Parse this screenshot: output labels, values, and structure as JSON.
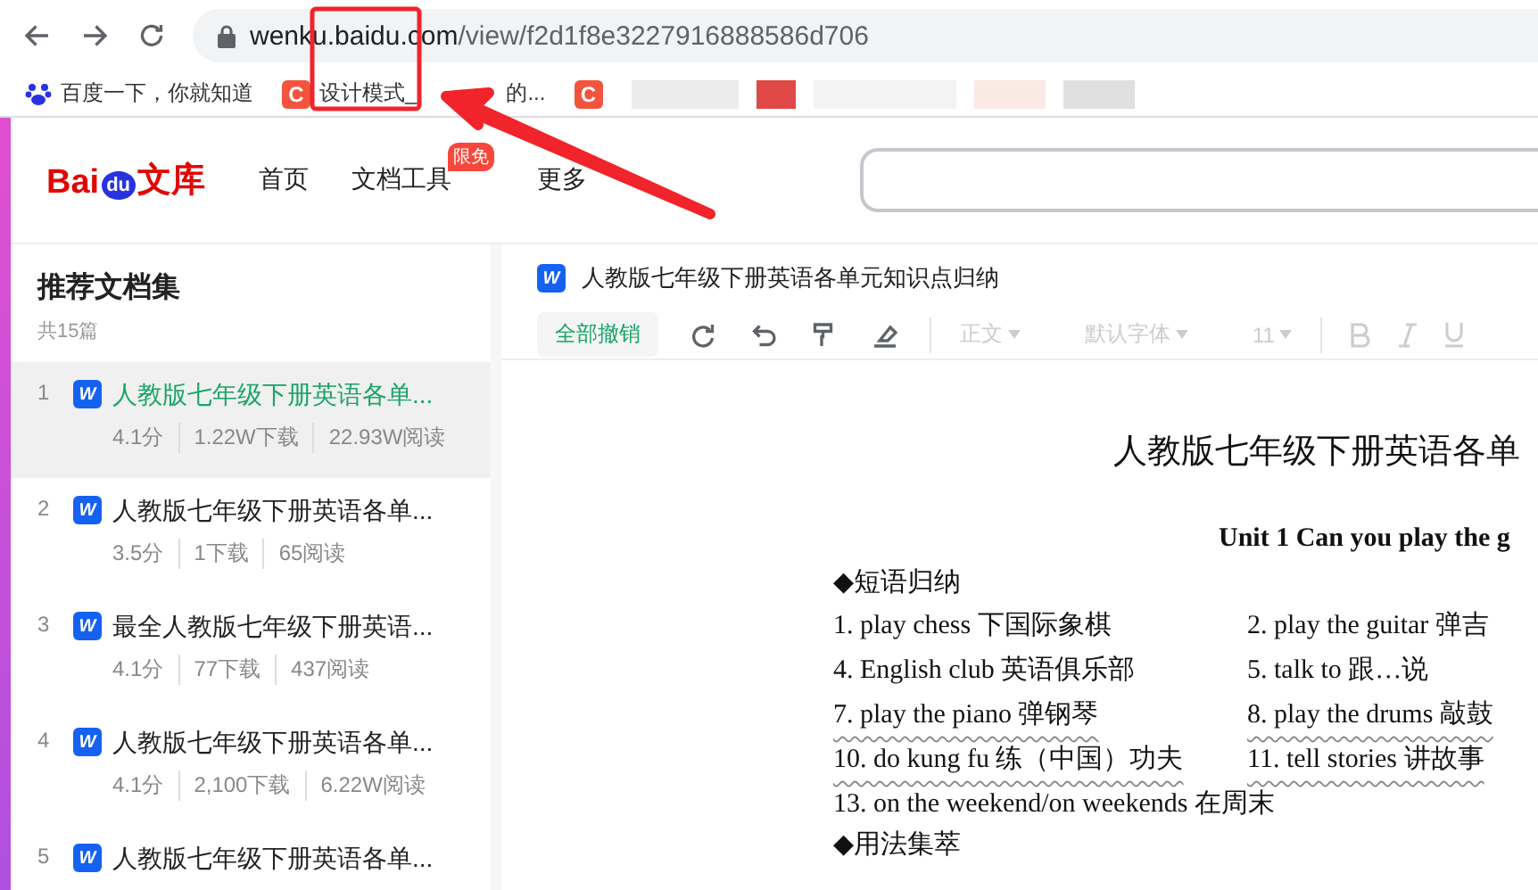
{
  "browser": {
    "url_host": "wenku.baidu.com",
    "url_path": "/view/f2d1f8e3227916888586d706"
  },
  "bookmarks": [
    {
      "kind": "paw",
      "label": "百度一下，你就知道"
    },
    {
      "kind": "c",
      "icon": "C",
      "label": "设计模式_",
      "label_2": "的..."
    },
    {
      "kind": "c",
      "icon": "C"
    }
  ],
  "site": {
    "logo_main": "Bai",
    "logo_du": "du",
    "logo_suffix": "文库",
    "nav": [
      {
        "label": "首页"
      },
      {
        "label": "文档工具",
        "badge": "限免"
      },
      {
        "label": "更多"
      }
    ]
  },
  "sidebar": {
    "title": "推荐文档集",
    "count": "共15篇",
    "items": [
      {
        "index": "1",
        "icon": "W",
        "title": "人教版七年级下册英语各单...",
        "stats": [
          "4.1分",
          "1.22W下载",
          "22.93W阅读"
        ],
        "selected": true
      },
      {
        "index": "2",
        "icon": "W",
        "title": "人教版七年级下册英语各单...",
        "stats": [
          "3.5分",
          "1下载",
          "65阅读"
        ],
        "selected": false
      },
      {
        "index": "3",
        "icon": "W",
        "title": "最全人教版七年级下册英语...",
        "stats": [
          "4.1分",
          "77下载",
          "437阅读"
        ],
        "selected": false
      },
      {
        "index": "4",
        "icon": "W",
        "title": "人教版七年级下册英语各单...",
        "stats": [
          "4.1分",
          "2,100下载",
          "6.22W阅读"
        ],
        "selected": false
      },
      {
        "index": "5",
        "icon": "W",
        "title": "人教版七年级下册英语各单...",
        "selected": false
      }
    ]
  },
  "document": {
    "icon": "W",
    "title": "人教版七年级下册英语各单元知识点归纳",
    "toolbar": {
      "undo_all": "全部撤销",
      "style": "正文",
      "font": "默认字体",
      "size": "11"
    },
    "heading": "人教版七年级下册英语各单",
    "unit": "Unit 1 Can you play the g",
    "section_1": "◆短语归纳",
    "rows": [
      {
        "underlined": false,
        "cells": [
          "1. play chess  下国际象棋",
          "2. play the guitar  弹吉"
        ]
      },
      {
        "underlined": false,
        "cells": [
          "4. English club  英语俱乐部",
          "5. talk to  跟…说"
        ]
      },
      {
        "underlined": true,
        "cells": [
          "7. play the piano  弹钢琴",
          "8. play the drums  敲鼓"
        ]
      },
      {
        "underlined": true,
        "cells": [
          "10. do kung fu  练（中国）功夫",
          "11. tell stories  讲故事"
        ]
      },
      {
        "underlined": false,
        "cells": [
          "13. on the weekend/on weekends    在周末"
        ]
      }
    ],
    "section_2": "◆用法集萃"
  }
}
